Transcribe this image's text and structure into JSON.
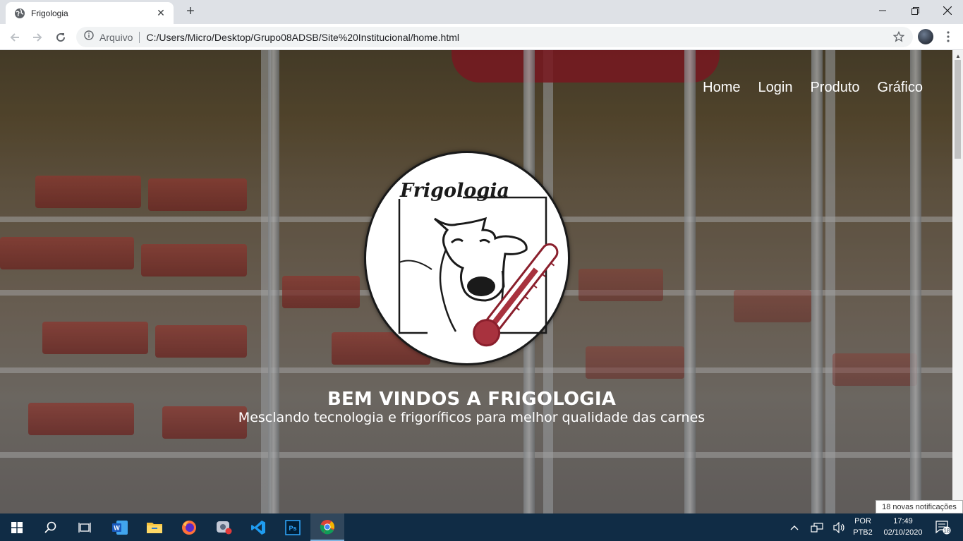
{
  "browser": {
    "tab_title": "Frigologia",
    "new_tab": "+",
    "address_chip": "Arquivo",
    "url": "C:/Users/Micro/Desktop/Grupo08ADSB/Site%20Institucional/home.html"
  },
  "page": {
    "nav": [
      "Home",
      "Login",
      "Produto",
      "Gráfico"
    ],
    "logo_text": "Frigologia",
    "hero_title": "BEM VINDOS A FRIGOLOGIA",
    "hero_subtitle": "Mesclando tecnologia e frigoríficos para melhor qualidade das carnes"
  },
  "notification": {
    "text": "18 novas notificações",
    "count": "18"
  },
  "taskbar": {
    "language_line1": "POR",
    "language_line2": "PTB2",
    "time": "17:49",
    "date": "02/10/2020",
    "apps": [
      "start-icon",
      "search-icon",
      "task-view-icon",
      "word-icon",
      "file-explorer-icon",
      "firefox-icon",
      "screen-recorder-icon",
      "vscode-icon",
      "photoshop-icon",
      "chrome-icon"
    ]
  },
  "colors": {
    "taskbar": "#102c45",
    "tabbar": "#dee1e6",
    "thermometer": "#a8323e"
  }
}
